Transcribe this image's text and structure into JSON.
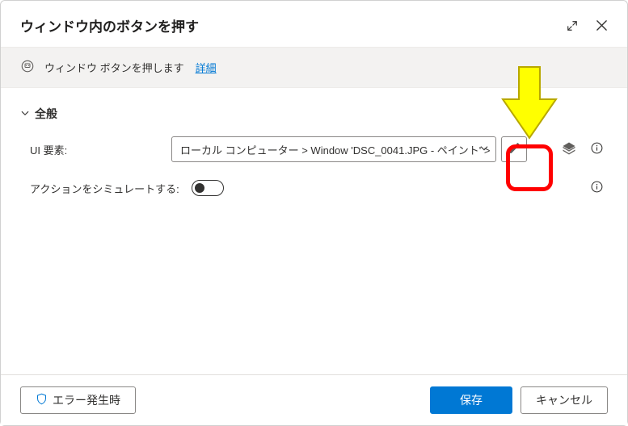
{
  "header": {
    "title": "ウィンドウ内のボタンを押す"
  },
  "infoBar": {
    "text": "ウィンドウ ボタンを押します",
    "linkText": "詳細"
  },
  "section": {
    "title": "全般"
  },
  "fields": {
    "uiElement": {
      "label": "UI 要素:",
      "value": "ローカル コンピューター > Window 'DSC_0041.JPG - ペイント' >"
    },
    "simulateAction": {
      "label": "アクションをシミュレートする:"
    }
  },
  "footer": {
    "errorBtn": "エラー発生時",
    "saveBtn": "保存",
    "cancelBtn": "キャンセル"
  },
  "icons": {
    "chevronDown": "chevron-down-icon",
    "pencil": "pencil-icon",
    "layers": "layers-icon",
    "info": "info-icon",
    "expand": "expand-icon",
    "close": "close-icon",
    "shield": "shield-icon",
    "robot": "robot-icon"
  }
}
